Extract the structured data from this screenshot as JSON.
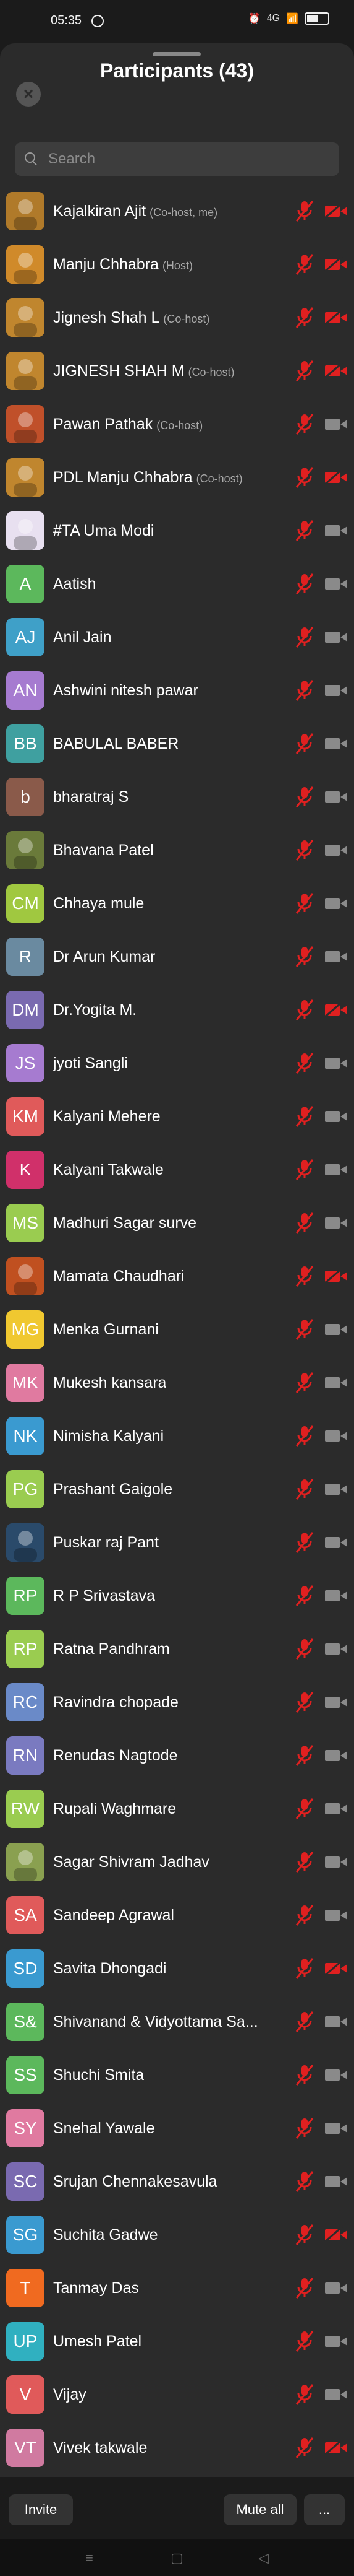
{
  "status_bar": {
    "time": "05:35",
    "network": "4G",
    "signal": "📶"
  },
  "header": {
    "title": "Participants (43)"
  },
  "search": {
    "placeholder": "Search"
  },
  "participants": [
    {
      "name": "Kajalkiran Ajit",
      "role": "(Co-host, me)",
      "avatar": "image",
      "color": "#b07a2a",
      "mic_muted": true,
      "cam_off": true
    },
    {
      "name": "Manju Chhabra",
      "role": "(Host)",
      "avatar": "image",
      "color": "#d08a2a",
      "mic_muted": true,
      "cam_off": true
    },
    {
      "name": "Jignesh Shah L",
      "role": "(Co-host)",
      "avatar": "image",
      "color": "#c0862e",
      "mic_muted": true,
      "cam_off": true
    },
    {
      "name": "JIGNESH SHAH M",
      "role": "(Co-host)",
      "avatar": "image",
      "color": "#c0862e",
      "mic_muted": true,
      "cam_off": true
    },
    {
      "name": "Pawan Pathak",
      "role": "(Co-host)",
      "avatar": "image",
      "color": "#c0502a",
      "mic_muted": true,
      "cam_off": false
    },
    {
      "name": "PDL Manju Chhabra",
      "role": "(Co-host)",
      "avatar": "image",
      "color": "#c0862e",
      "mic_muted": true,
      "cam_off": true
    },
    {
      "name": "#TA Uma Modi",
      "role": "",
      "avatar": "image",
      "color": "#e8e0f0",
      "mic_muted": true,
      "cam_off": false
    },
    {
      "name": "Aatish",
      "role": "",
      "avatar": "A",
      "color": "#5cb85c",
      "mic_muted": true,
      "cam_off": false
    },
    {
      "name": "Anil Jain",
      "role": "",
      "avatar": "AJ",
      "color": "#3fa0c8",
      "mic_muted": true,
      "cam_off": false
    },
    {
      "name": "Ashwini nitesh pawar",
      "role": "",
      "avatar": "AN",
      "color": "#a67bd0",
      "mic_muted": true,
      "cam_off": false
    },
    {
      "name": "BABULAL BABER",
      "role": "",
      "avatar": "BB",
      "color": "#3fa0a0",
      "mic_muted": true,
      "cam_off": false
    },
    {
      "name": "bharatraj S",
      "role": "",
      "avatar": "b",
      "color": "#8a5a4a",
      "mic_muted": true,
      "cam_off": false
    },
    {
      "name": "Bhavana Patel",
      "role": "",
      "avatar": "image",
      "color": "#6a7a3a",
      "mic_muted": true,
      "cam_off": false
    },
    {
      "name": "Chhaya mule",
      "role": "",
      "avatar": "CM",
      "color": "#a0c840",
      "mic_muted": true,
      "cam_off": false
    },
    {
      "name": "Dr Arun Kumar",
      "role": "",
      "avatar": "R",
      "color": "#6a8aa0",
      "mic_muted": true,
      "cam_off": false
    },
    {
      "name": "Dr.Yogita M.",
      "role": "",
      "avatar": "DM",
      "color": "#7a6ab0",
      "mic_muted": true,
      "cam_off": true
    },
    {
      "name": "jyoti Sangli",
      "role": "",
      "avatar": "JS",
      "color": "#a67bd0",
      "mic_muted": true,
      "cam_off": false
    },
    {
      "name": "Kalyani Mehere",
      "role": "",
      "avatar": "KM",
      "color": "#e05a5a",
      "mic_muted": true,
      "cam_off": false
    },
    {
      "name": "Kalyani Takwale",
      "role": "",
      "avatar": "K",
      "color": "#d0306a",
      "mic_muted": true,
      "cam_off": false
    },
    {
      "name": "Madhuri Sagar surve",
      "role": "",
      "avatar": "MS",
      "color": "#9acc50",
      "mic_muted": true,
      "cam_off": false
    },
    {
      "name": "Mamata Chaudhari",
      "role": "",
      "avatar": "image",
      "color": "#c05020",
      "mic_muted": true,
      "cam_off": true
    },
    {
      "name": "Menka Gurnani",
      "role": "",
      "avatar": "MG",
      "color": "#f0c830",
      "mic_muted": true,
      "cam_off": false
    },
    {
      "name": "Mukesh kansara",
      "role": "",
      "avatar": "MK",
      "color": "#e07aa0",
      "mic_muted": true,
      "cam_off": false
    },
    {
      "name": "Nimisha Kalyani",
      "role": "",
      "avatar": "NK",
      "color": "#3a9ad0",
      "mic_muted": true,
      "cam_off": false
    },
    {
      "name": "Prashant Gaigole",
      "role": "",
      "avatar": "PG",
      "color": "#9acc50",
      "mic_muted": true,
      "cam_off": false
    },
    {
      "name": "Puskar raj Pant",
      "role": "",
      "avatar": "image",
      "color": "#2a4a6a",
      "mic_muted": true,
      "cam_off": false
    },
    {
      "name": "R P Srivastava",
      "role": "",
      "avatar": "RP",
      "color": "#5cb85c",
      "mic_muted": true,
      "cam_off": false
    },
    {
      "name": "Ratna Pandhram",
      "role": "",
      "avatar": "RP",
      "color": "#9acc50",
      "mic_muted": true,
      "cam_off": false
    },
    {
      "name": "Ravindra chopade",
      "role": "",
      "avatar": "RC",
      "color": "#6a8ac8",
      "mic_muted": true,
      "cam_off": false
    },
    {
      "name": "Renudas Nagtode",
      "role": "",
      "avatar": "RN",
      "color": "#7a7ac0",
      "mic_muted": true,
      "cam_off": false
    },
    {
      "name": "Rupali Waghmare",
      "role": "",
      "avatar": "RW",
      "color": "#9acc50",
      "mic_muted": true,
      "cam_off": false
    },
    {
      "name": "Sagar Shivram Jadhav",
      "role": "",
      "avatar": "image",
      "color": "#8aa050",
      "mic_muted": true,
      "cam_off": false
    },
    {
      "name": "Sandeep Agrawal",
      "role": "",
      "avatar": "SA",
      "color": "#e05a5a",
      "mic_muted": true,
      "cam_off": false
    },
    {
      "name": "Savita Dhongadi",
      "role": "",
      "avatar": "SD",
      "color": "#3a9ad0",
      "mic_muted": true,
      "cam_off": true
    },
    {
      "name": "Shivanand & Vidyottama Sa...",
      "role": "",
      "avatar": "S&",
      "color": "#5cb85c",
      "mic_muted": true,
      "cam_off": false
    },
    {
      "name": "Shuchi Smita",
      "role": "",
      "avatar": "SS",
      "color": "#5cb85c",
      "mic_muted": true,
      "cam_off": false
    },
    {
      "name": "Snehal Yawale",
      "role": "",
      "avatar": "SY",
      "color": "#e07aa0",
      "mic_muted": true,
      "cam_off": false
    },
    {
      "name": "Srujan Chennakesavula",
      "role": "",
      "avatar": "SC",
      "color": "#7a6ab0",
      "mic_muted": true,
      "cam_off": false
    },
    {
      "name": "Suchita Gadwe",
      "role": "",
      "avatar": "SG",
      "color": "#3a9ad0",
      "mic_muted": true,
      "cam_off": true
    },
    {
      "name": "Tanmay Das",
      "role": "",
      "avatar": "T",
      "color": "#f06a20",
      "mic_muted": true,
      "cam_off": false
    },
    {
      "name": "Umesh Patel",
      "role": "",
      "avatar": "UP",
      "color": "#30b0c0",
      "mic_muted": true,
      "cam_off": false
    },
    {
      "name": "Vijay",
      "role": "",
      "avatar": "V",
      "color": "#e05a5a",
      "mic_muted": true,
      "cam_off": false
    },
    {
      "name": "Vivek takwale",
      "role": "",
      "avatar": "VT",
      "color": "#d07aa0",
      "mic_muted": true,
      "cam_off": true
    }
  ],
  "footer": {
    "invite_label": "Invite",
    "mute_all_label": "Mute all",
    "more_label": "..."
  },
  "colors": {
    "muted_red": "#e02020",
    "cam_gray": "#8a8a8a"
  }
}
